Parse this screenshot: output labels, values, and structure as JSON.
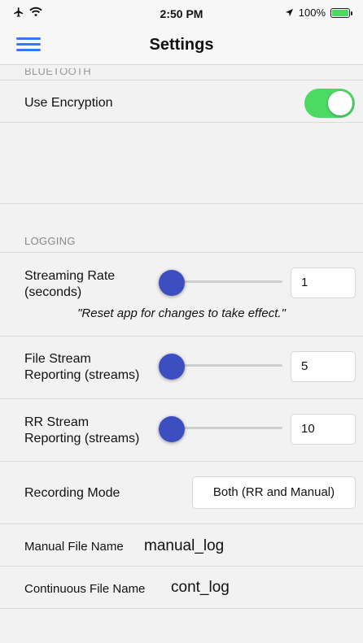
{
  "status_bar": {
    "time": "2:50 PM",
    "battery_text": "100%",
    "airplane_icon": "airplane-icon",
    "wifi_icon": "wifi-icon",
    "location_icon": "location-arrow-icon",
    "battery_icon": "battery-charging-icon"
  },
  "nav": {
    "title": "Settings",
    "menu_icon": "hamburger-menu-icon",
    "accent_color": "#3478f6"
  },
  "bluetooth": {
    "header": "BLUETOOTH",
    "use_encryption_label": "Use Encryption",
    "use_encryption_on": true,
    "toggle_color": "#4cd964"
  },
  "logging": {
    "header": "LOGGING",
    "streaming_rate_label_line1": "Streaming Rate",
    "streaming_rate_label_line2": "(seconds)",
    "streaming_rate_value": "1",
    "reset_note": "\"Reset app for changes to take effect.\"",
    "file_stream_label_line1": "File Stream",
    "file_stream_label_line2": "Reporting (streams)",
    "file_stream_value": "5",
    "rr_stream_label_line1": "RR Stream",
    "rr_stream_label_line2": "Reporting (streams)",
    "rr_stream_value": "10",
    "slider_color": "#3d4fc0",
    "recording_mode_label": "Recording Mode",
    "recording_mode_value": "Both (RR and Manual)",
    "manual_file_label": "Manual File Name",
    "manual_file_value": "manual_log",
    "continuous_file_label": "Continuous File Name",
    "continuous_file_value": "cont_log"
  }
}
